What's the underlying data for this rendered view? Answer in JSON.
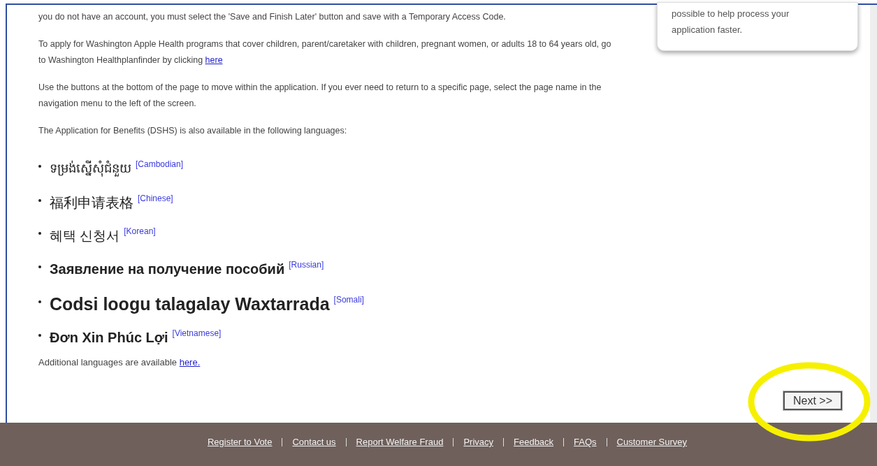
{
  "intro_paragraphs": [
    {
      "text": "you do not have an account, you must select the 'Save and Finish Later' button and save with a Temporary Access Code."
    },
    {
      "text": "To apply for Washington Apple Health programs that cover children, parent/caretaker with children, pregnant women, or adults 18 to 64 years old, go to Washington Healthplanfinder by clicking ",
      "link": "here"
    },
    {
      "text": "Use the buttons at the bottom of the page to move within the application. If you ever need to return to a specific page, select the page name in the navigation menu to the left of the screen."
    },
    {
      "text": "The Application for Benefits (DSHS) is also available in the following languages:"
    }
  ],
  "side_card": {
    "text": "possible to help process your application faster."
  },
  "languages": [
    {
      "name": "ទម្រង់ស្នើសុំជំនួយ",
      "label": "[Cambodian]"
    },
    {
      "name": "福利申请表格",
      "label": "[Chinese]"
    },
    {
      "name": "혜택 신청서",
      "label": "[Korean]"
    },
    {
      "name": "Заявление на получение пособий",
      "label": "[Russian]"
    },
    {
      "name": "Codsi loogu talagalay Waxtarrada",
      "label": "[Somali]"
    },
    {
      "name": "Đơn Xin Phúc Lợi",
      "label": "[Vietnamese]"
    }
  ],
  "additional": {
    "text": "Additional languages are available ",
    "link": "here."
  },
  "next_button": {
    "label": "Next >>"
  },
  "footer_links": [
    "Register to Vote",
    "Contact us",
    "Report Welfare Fraud",
    "Privacy",
    "Feedback",
    "FAQs",
    "Customer Survey"
  ]
}
